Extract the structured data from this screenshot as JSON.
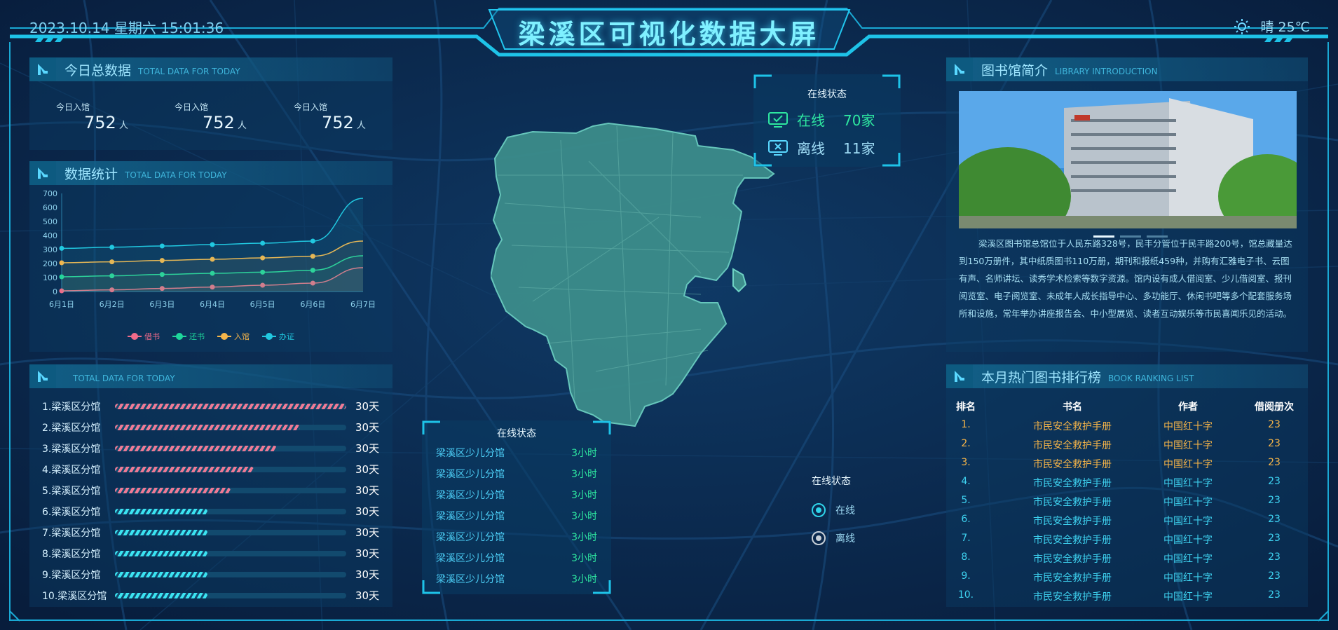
{
  "header": {
    "datetime": "2023.10.14 星期六 15:01:36",
    "title": "梁溪区可视化数据大屏",
    "weather": "晴 25℃",
    "weather_icon": "sun-icon"
  },
  "today_total": {
    "title": "今日总数据",
    "subtitle": "TOTAL DATA FOR TODAY",
    "stats": [
      {
        "label": "今日入馆",
        "value": "752",
        "unit": "人"
      },
      {
        "label": "今日入馆",
        "value": "752",
        "unit": "人"
      },
      {
        "label": "今日入馆",
        "value": "752",
        "unit": "人"
      }
    ]
  },
  "stats_chart": {
    "title": "数据统计",
    "subtitle": "TOTAL DATA FOR TODAY"
  },
  "chart_data": {
    "type": "line",
    "categories": [
      "6月1日",
      "6月2日",
      "6月3日",
      "6月4日",
      "6月5日",
      "6月6日",
      "6月7日"
    ],
    "ylim": [
      0,
      700
    ],
    "yticks": [
      0,
      100,
      200,
      300,
      400,
      500,
      600,
      700
    ],
    "grid": false,
    "legend": "bottom",
    "series": [
      {
        "name": "借书",
        "color": "#f06b8a",
        "values": [
          5,
          12,
          22,
          32,
          45,
          60,
          170
        ]
      },
      {
        "name": "还书",
        "color": "#1ed69b",
        "values": [
          105,
          112,
          122,
          130,
          138,
          152,
          255
        ]
      },
      {
        "name": "入馆",
        "color": "#f6b64a",
        "values": [
          205,
          212,
          222,
          230,
          240,
          252,
          360
        ]
      },
      {
        "name": "办证",
        "color": "#21c8e0",
        "values": [
          308,
          316,
          325,
          335,
          345,
          360,
          665
        ]
      }
    ]
  },
  "ranking": {
    "subtitle": "TOTAL DATA FOR TODAY",
    "items": [
      {
        "name": "1.梁溪区分馆",
        "value": "30天",
        "fill": 1.0,
        "color": "pink"
      },
      {
        "name": "2.梁溪区分馆",
        "value": "30天",
        "fill": 0.8,
        "color": "pink"
      },
      {
        "name": "3.梁溪区分馆",
        "value": "30天",
        "fill": 0.7,
        "color": "pink"
      },
      {
        "name": "4.梁溪区分馆",
        "value": "30天",
        "fill": 0.6,
        "color": "pink"
      },
      {
        "name": "5.梁溪区分馆",
        "value": "30天",
        "fill": 0.5,
        "color": "pink"
      },
      {
        "name": "6.梁溪区分馆",
        "value": "30天",
        "fill": 0.4,
        "color": "cyan"
      },
      {
        "name": "7.梁溪区分馆",
        "value": "30天",
        "fill": 0.4,
        "color": "cyan"
      },
      {
        "name": "8.梁溪区分馆",
        "value": "30天",
        "fill": 0.4,
        "color": "cyan"
      },
      {
        "name": "9.梁溪区分馆",
        "value": "30天",
        "fill": 0.4,
        "color": "cyan"
      },
      {
        "name": "10.梁溪区分馆",
        "value": "30天",
        "fill": 0.4,
        "color": "cyan"
      }
    ]
  },
  "online_box_top": {
    "title": "在线状态",
    "online_label": "在线",
    "online_value": "70家",
    "offline_label": "离线",
    "offline_value": "11家"
  },
  "online_box_bottom": {
    "title": "在线状态",
    "rows": [
      {
        "name": "梁溪区少儿分馆",
        "time": "3小时"
      },
      {
        "name": "梁溪区少儿分馆",
        "time": "3小时"
      },
      {
        "name": "梁溪区少儿分馆",
        "time": "3小时"
      },
      {
        "name": "梁溪区少儿分馆",
        "time": "3小时"
      },
      {
        "name": "梁溪区少儿分馆",
        "time": "3小时"
      },
      {
        "name": "梁溪区少儿分馆",
        "time": "3小时"
      },
      {
        "name": "梁溪区少儿分馆",
        "time": "3小时"
      }
    ]
  },
  "map_legend": {
    "title": "在线状态",
    "online": "在线",
    "offline": "离线",
    "online_color": "#2fd4ea",
    "offline_color": "#c8d0d8"
  },
  "library": {
    "title": "图书馆简介",
    "subtitle": "LIBRARY INTRODUCTION",
    "text": "梁溪区图书馆总馆位于人民东路328号，民丰分管位于民丰路200号，馆总藏量达到150万册件，其中纸质图书110万册，期刊和报纸459种，并购有汇雅电子书、云图有声、名师讲坛、读秀学术检索等数字资源。馆内设有成人借阅室、少儿借阅室、报刊阅览室、电子阅览室、未成年人成长指导中心、多功能厅、休闲书吧等多个配套服务场所和设施，常年举办讲座报告会、中小型展览、读者互动娱乐等市民喜闻乐见的活动。",
    "carousel_count": 3,
    "carousel_active": 0
  },
  "books": {
    "title": "本月热门图书排行榜",
    "subtitle": "BOOK RANKING LIST",
    "columns": [
      "排名",
      "书名",
      "作者",
      "借阅册次"
    ],
    "rows": [
      {
        "rank": "1.",
        "title": "市民安全救护手册",
        "author": "中国红十字",
        "count": "23",
        "top": true
      },
      {
        "rank": "2.",
        "title": "市民安全救护手册",
        "author": "中国红十字",
        "count": "23",
        "top": true
      },
      {
        "rank": "3.",
        "title": "市民安全救护手册",
        "author": "中国红十字",
        "count": "23",
        "top": true
      },
      {
        "rank": "4.",
        "title": "市民安全救护手册",
        "author": "中国红十字",
        "count": "23",
        "top": false
      },
      {
        "rank": "5.",
        "title": "市民安全救护手册",
        "author": "中国红十字",
        "count": "23",
        "top": false
      },
      {
        "rank": "6.",
        "title": "市民安全救护手册",
        "author": "中国红十字",
        "count": "23",
        "top": false
      },
      {
        "rank": "7.",
        "title": "市民安全救护手册",
        "author": "中国红十字",
        "count": "23",
        "top": false
      },
      {
        "rank": "8.",
        "title": "市民安全救护手册",
        "author": "中国红十字",
        "count": "23",
        "top": false
      },
      {
        "rank": "9.",
        "title": "市民安全救护手册",
        "author": "中国红十字",
        "count": "23",
        "top": false
      },
      {
        "rank": "10.",
        "title": "市民安全救护手册",
        "author": "中国红十字",
        "count": "23",
        "top": false
      }
    ]
  },
  "colors": {
    "accent": "#2fd4ea",
    "top_rank": "#f7b548",
    "normal_rank": "#3ed2f0"
  }
}
